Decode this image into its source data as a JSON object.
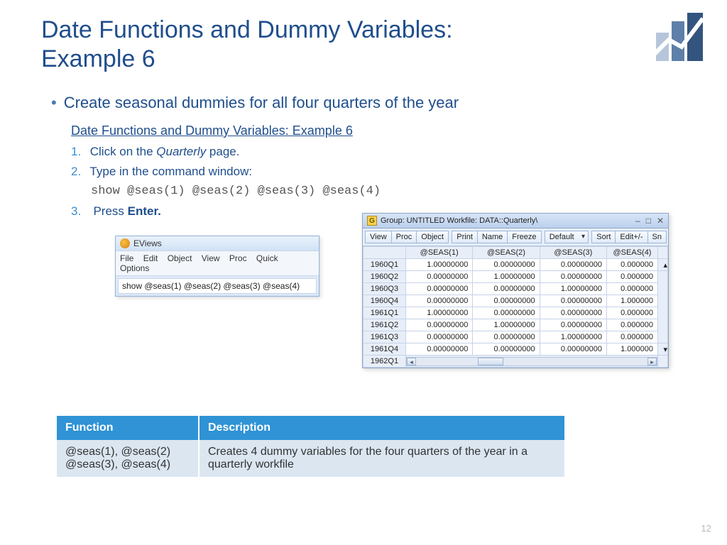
{
  "title": "Date Functions and Dummy Variables: Example 6",
  "bullet": "Create seasonal dummies for all four quarters of the year",
  "subtitle_link": "Date Functions and Dummy Variables: Example 6",
  "steps": {
    "s1a": "Click on the ",
    "s1b": "Quarterly",
    "s1c": " page.",
    "s2": "Type in the command window:",
    "code": "show @seas(1) @seas(2) @seas(3) @seas(4)",
    "s3a": "Press ",
    "s3b": "Enter."
  },
  "eviews": {
    "app": "EViews",
    "menu": [
      "File",
      "Edit",
      "Object",
      "View",
      "Proc",
      "Quick",
      "Options"
    ],
    "cmd": "show @seas(1) @seas(2) @seas(3) @seas(4)"
  },
  "group": {
    "title": "Group: UNTITLED   Workfile: DATA::Quarterly\\",
    "toolbar": [
      "View",
      "Proc",
      "Object",
      "Print",
      "Name",
      "Freeze",
      "Default",
      "Sort",
      "Edit+/-",
      "Sn"
    ],
    "headers": [
      "@SEAS(1)",
      "@SEAS(2)",
      "@SEAS(3)",
      "@SEAS(4)"
    ],
    "minimize": "–",
    "maximize": "□",
    "close": "✕",
    "scroll_up": "▴",
    "scroll_down": "▾",
    "rows": [
      {
        "h": "1960Q1",
        "v": [
          "1.00000000",
          "0.00000000",
          "0.00000000",
          "0.000000"
        ]
      },
      {
        "h": "1960Q2",
        "v": [
          "0.00000000",
          "1.00000000",
          "0.00000000",
          "0.000000"
        ]
      },
      {
        "h": "1960Q3",
        "v": [
          "0.00000000",
          "0.00000000",
          "1.00000000",
          "0.000000"
        ]
      },
      {
        "h": "1960Q4",
        "v": [
          "0.00000000",
          "0.00000000",
          "0.00000000",
          "1.000000"
        ]
      },
      {
        "h": "1961Q1",
        "v": [
          "1.00000000",
          "0.00000000",
          "0.00000000",
          "0.000000"
        ]
      },
      {
        "h": "1961Q2",
        "v": [
          "0.00000000",
          "1.00000000",
          "0.00000000",
          "0.000000"
        ]
      },
      {
        "h": "1961Q3",
        "v": [
          "0.00000000",
          "0.00000000",
          "1.00000000",
          "0.000000"
        ]
      },
      {
        "h": "1961Q4",
        "v": [
          "0.00000000",
          "0.00000000",
          "0.00000000",
          "1.000000"
        ]
      },
      {
        "h": "1962Q1",
        "v": [
          "",
          "",
          "",
          ""
        ]
      }
    ]
  },
  "fn_table": {
    "h1": "Function",
    "h2": "Description",
    "c1a": "@seas(1), @seas(2)",
    "c1b": "@seas(3), @seas(4)",
    "c2": "Creates 4 dummy variables for the four quarters of the year in a quarterly workfile"
  },
  "pagenum": "12"
}
